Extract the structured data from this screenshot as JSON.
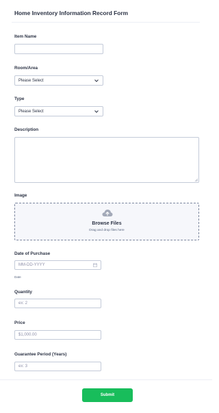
{
  "form": {
    "title": "Home Inventory Information Record Form"
  },
  "fields": {
    "item_name": {
      "label": "Item Name",
      "value": "",
      "placeholder": ""
    },
    "room_area": {
      "label": "Room/Area",
      "selected": "Please Select"
    },
    "type": {
      "label": "Type",
      "selected": "Please Select"
    },
    "description": {
      "label": "Description",
      "value": ""
    },
    "image": {
      "label": "Image",
      "browse_label": "Browse Files",
      "drag_label": "Drag and drop files here",
      "icon": "cloud-upload-icon"
    },
    "date_of_purchase": {
      "label": "Date of Purchase",
      "placeholder": "MM-DD-YYYY",
      "sublabel": "Date",
      "icon": "calendar-icon"
    },
    "quantity": {
      "label": "Quantity",
      "placeholder": "ex: 2"
    },
    "price": {
      "label": "Price",
      "placeholder": "$1,000.00"
    },
    "guarantee_period": {
      "label": "Guarantee Period (Years)",
      "placeholder": "ex: 3"
    }
  },
  "actions": {
    "submit_label": "Submit",
    "submit_color": "#18bd5b"
  }
}
